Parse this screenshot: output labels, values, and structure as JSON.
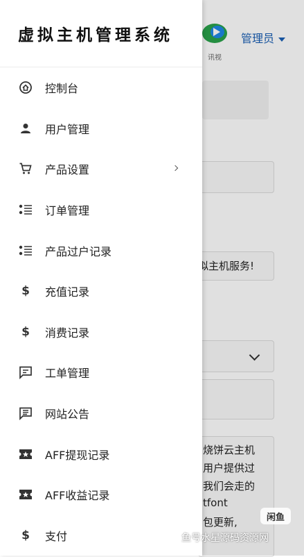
{
  "drawer": {
    "title": "虚拟主机管理系统",
    "items": [
      {
        "label": "控制台",
        "icon": "home-icon"
      },
      {
        "label": "用户管理",
        "icon": "person-icon"
      },
      {
        "label": "产品设置",
        "icon": "cart-icon",
        "has_submenu": true
      },
      {
        "label": "订单管理",
        "icon": "list-icon"
      },
      {
        "label": "产品过户记录",
        "icon": "list-icon"
      },
      {
        "label": "充值记录",
        "icon": "dollar-icon"
      },
      {
        "label": "消费记录",
        "icon": "dollar-icon"
      },
      {
        "label": "工单管理",
        "icon": "message-icon"
      },
      {
        "label": "网站公告",
        "icon": "announcement-icon"
      },
      {
        "label": "AFF提现记录",
        "icon": "ticket-star-icon"
      },
      {
        "label": "AFF收益记录",
        "icon": "ticket-star-icon"
      },
      {
        "label": "支付",
        "icon": "dollar-icon"
      }
    ]
  },
  "background": {
    "user_menu_label": "管理员",
    "logo_text": "讯视",
    "notice_fragment": "拟主机服务!",
    "content_lines": [
      "烧饼云主机",
      "用户提供过",
      "我们会走的",
      "tfont",
      "包更新,"
    ]
  },
  "watermark": {
    "badge": "闲鱼",
    "text": "鱼号水星源码资源网"
  }
}
